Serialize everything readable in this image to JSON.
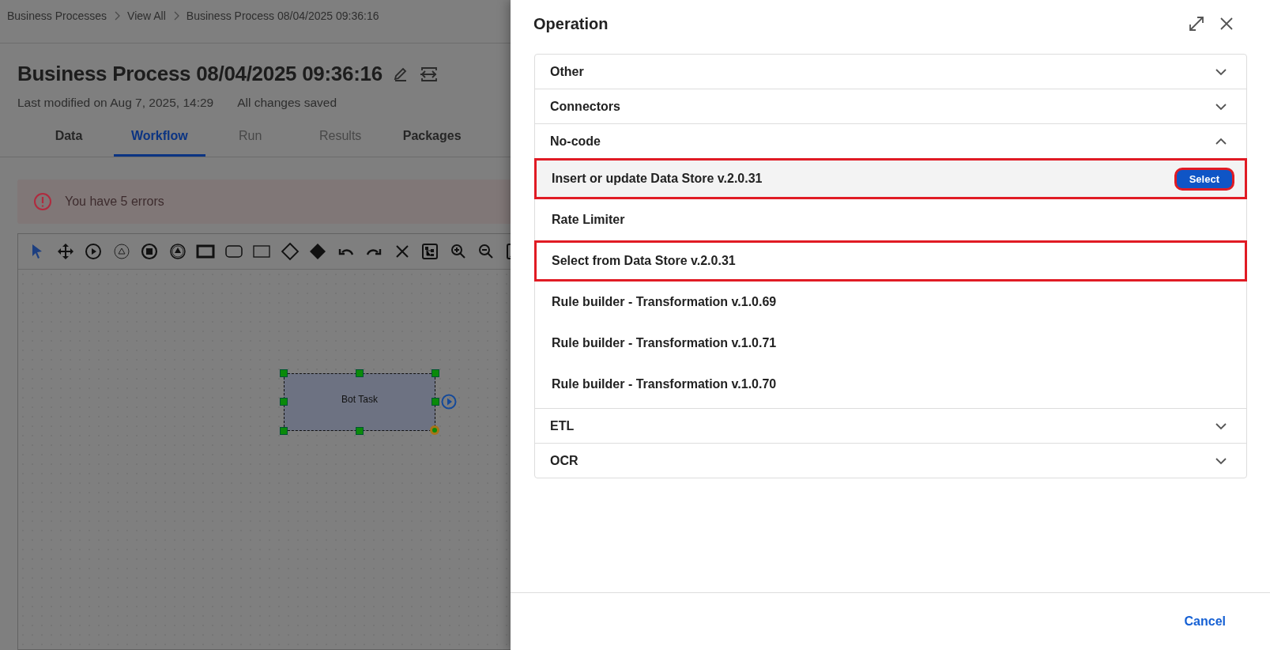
{
  "breadcrumb": [
    "Business Processes",
    "View All",
    "Business Process 08/04/2025 09:36:16"
  ],
  "title": "Business Process 08/04/2025 09:36:16",
  "last_modified": "Last modified on Aug 7, 2025, 14:29",
  "save_status": "All changes saved",
  "tabs": [
    {
      "label": "Data",
      "selected": false,
      "disabled": false
    },
    {
      "label": "Workflow",
      "selected": true,
      "disabled": false
    },
    {
      "label": "Run",
      "selected": false,
      "disabled": true
    },
    {
      "label": "Results",
      "selected": false,
      "disabled": true
    },
    {
      "label": "Packages",
      "selected": false,
      "disabled": false
    }
  ],
  "alert": {
    "message": "You have 5 errors"
  },
  "canvas": {
    "nodes": [
      {
        "label": "Bot Task",
        "selected": true
      }
    ]
  },
  "panel": {
    "title": "Operation",
    "cancel": "Cancel",
    "groups": [
      {
        "label": "Other",
        "expanded": false
      },
      {
        "label": "Connectors",
        "expanded": false
      },
      {
        "label": "No-code",
        "expanded": true,
        "items": [
          {
            "label": "Insert or update Data Store v.2.0.31",
            "hovered": true,
            "highlighted": true,
            "button": "Select"
          },
          {
            "label": "Rate Limiter",
            "hovered": false,
            "highlighted": false
          },
          {
            "label": "Select from Data Store v.2.0.31",
            "hovered": false,
            "highlighted": true
          },
          {
            "label": "Rule builder - Transformation v.1.0.69",
            "hovered": false,
            "highlighted": false
          },
          {
            "label": "Rule builder - Transformation v.1.0.71",
            "hovered": false,
            "highlighted": false
          },
          {
            "label": "Rule builder - Transformation v.1.0.70",
            "hovered": false,
            "highlighted": false
          }
        ]
      },
      {
        "label": "ETL",
        "expanded": false
      },
      {
        "label": "OCR",
        "expanded": false
      }
    ]
  }
}
